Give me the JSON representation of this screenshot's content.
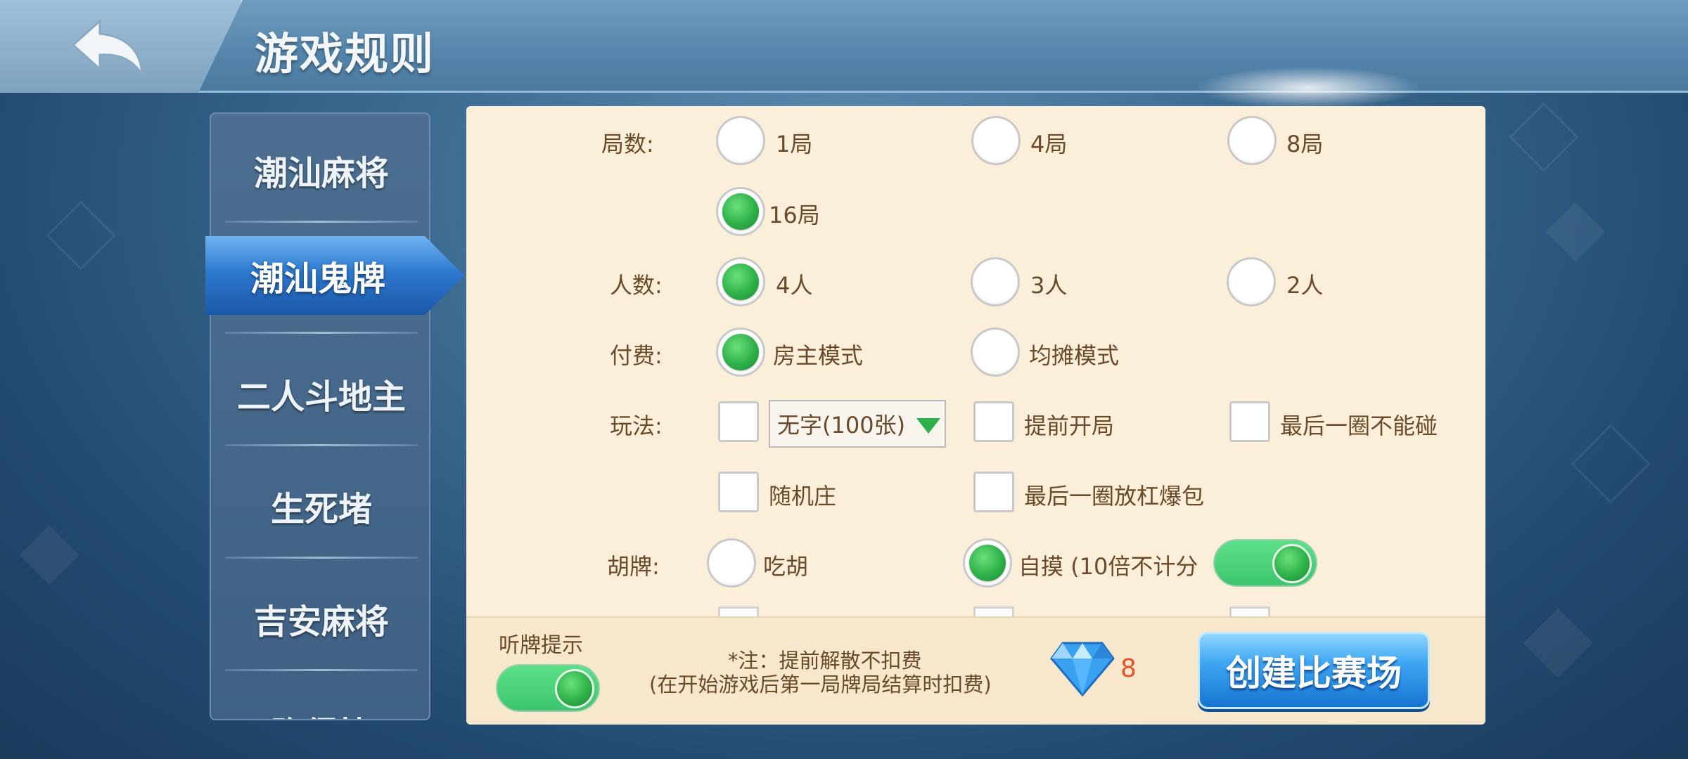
{
  "header": {
    "title": "游戏规则"
  },
  "sidebar": {
    "items": [
      {
        "label": "潮汕麻将"
      },
      {
        "label": "潮汕鬼牌",
        "active": true
      },
      {
        "label": "二人斗地主"
      },
      {
        "label": "生死堵"
      },
      {
        "label": "吉安麻将"
      },
      {
        "label": "跑得快"
      }
    ]
  },
  "rules": {
    "rounds": {
      "label": "局数:",
      "options": [
        "1局",
        "4局",
        "8局",
        "16局"
      ],
      "selected": "16局"
    },
    "players": {
      "label": "人数:",
      "options": [
        "4人",
        "3人",
        "2人"
      ],
      "selected": "4人"
    },
    "payment": {
      "label": "付费:",
      "options": [
        "房主模式",
        "均摊模式"
      ],
      "selected": "房主模式"
    },
    "play": {
      "label": "玩法:",
      "dropdown_value": "无字(100张)",
      "options": [
        "提前开局",
        "最后一圈不能碰",
        "随机庄",
        "最后一圈放杠爆包"
      ]
    },
    "hu": {
      "label": "胡牌:",
      "options": [
        "吃胡",
        "自摸 (10倍不计分"
      ],
      "selected": "自摸 (10倍不计分",
      "toggle_on": true
    }
  },
  "footer": {
    "hint_label": "听牌提示",
    "hint_toggle_on": true,
    "note_line1": "*注：提前解散不扣费",
    "note_line2": "(在开始游戏后第一局牌局结算时扣费)",
    "diamond_count": "8",
    "create_label": "创建比赛场"
  },
  "colors": {
    "accent_green": "#2fb14a",
    "panel_bg": "#fcefd9",
    "text_brown": "#6b4a2c",
    "count_red": "#e8502e"
  }
}
